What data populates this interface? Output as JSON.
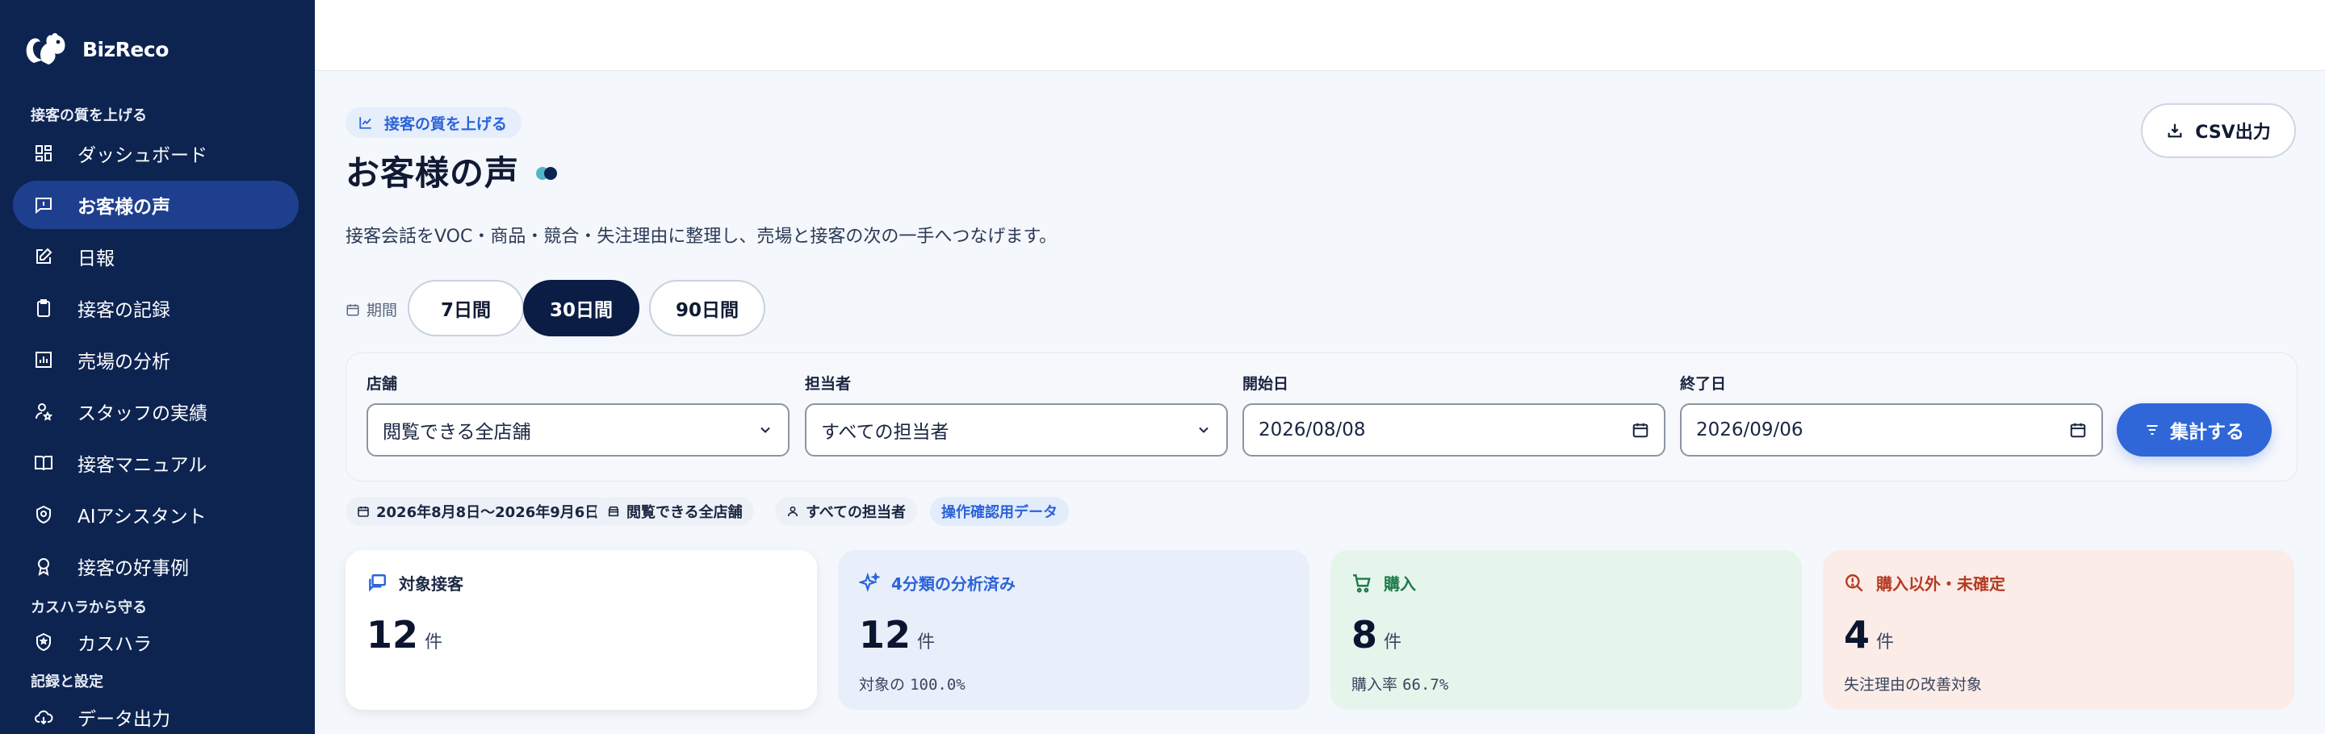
{
  "brand": {
    "name": "BizReco"
  },
  "sidebar": {
    "sections": [
      "接客の質を上げる",
      "カスハラから守る",
      "記録と設定"
    ],
    "items": [
      {
        "label": "ダッシュボード",
        "icon": "dashboard-icon"
      },
      {
        "label": "お客様の声",
        "icon": "message-icon"
      },
      {
        "label": "日報",
        "icon": "edit-icon"
      },
      {
        "label": "接客の記録",
        "icon": "clipboard-icon"
      },
      {
        "label": "売場の分析",
        "icon": "bar-chart-icon"
      },
      {
        "label": "スタッフの実績",
        "icon": "user-star-icon"
      },
      {
        "label": "接客マニュアル",
        "icon": "book-icon"
      },
      {
        "label": "AIアシスタント",
        "icon": "ai-assistant-icon"
      },
      {
        "label": "接客の好事例",
        "icon": "award-icon"
      },
      {
        "label": "カスハラ",
        "icon": "shield-icon"
      },
      {
        "label": "データ出力",
        "icon": "cloud-download-icon"
      }
    ]
  },
  "page": {
    "chip": "接客の質を上げる",
    "title": "お客様の声",
    "subtitle": "接客会話をVOC・商品・競合・失注理由に整理し、売場と接客の次の一手へつなげます。",
    "csv_label": "CSV出力"
  },
  "period": {
    "label": "期間",
    "options": [
      "7日間",
      "30日間",
      "90日間"
    ],
    "selected": "30日間"
  },
  "filters": {
    "store": {
      "label": "店舗",
      "value": "閲覧できる全店舗"
    },
    "staff": {
      "label": "担当者",
      "value": "すべての担当者"
    },
    "start": {
      "label": "開始日",
      "value": "2026/08/08"
    },
    "end": {
      "label": "終了日",
      "value": "2026/09/06"
    },
    "submit_label": "集計する"
  },
  "active_tags": {
    "range": "2026年8月8日〜2026年9月6日",
    "store": "閲覧できる全店舗",
    "staff": "すべての担当者",
    "mode": "操作確認用データ"
  },
  "cards": [
    {
      "title": "対象接客",
      "value": "12",
      "unit": "件",
      "note": "",
      "color": "#1e2a44"
    },
    {
      "title": "4分類の分析済み",
      "value": "12",
      "unit": "件",
      "note_prefix": "対象の",
      "note_value": "100.0%",
      "color": "#2b63d9"
    },
    {
      "title": "購入",
      "value": "8",
      "unit": "件",
      "note_prefix": "購入率",
      "note_value": "66.7%",
      "color": "#1d7a4a"
    },
    {
      "title": "購入以外・未確定",
      "value": "4",
      "unit": "件",
      "note": "失注理由の改善対象",
      "color": "#b53a22"
    }
  ],
  "colors": {
    "sidebar_bg": "#0d2451",
    "accent": "#2f67d8",
    "card_blue": "#e8effb",
    "card_green": "#e6f5ec",
    "card_red": "#fcece7"
  }
}
